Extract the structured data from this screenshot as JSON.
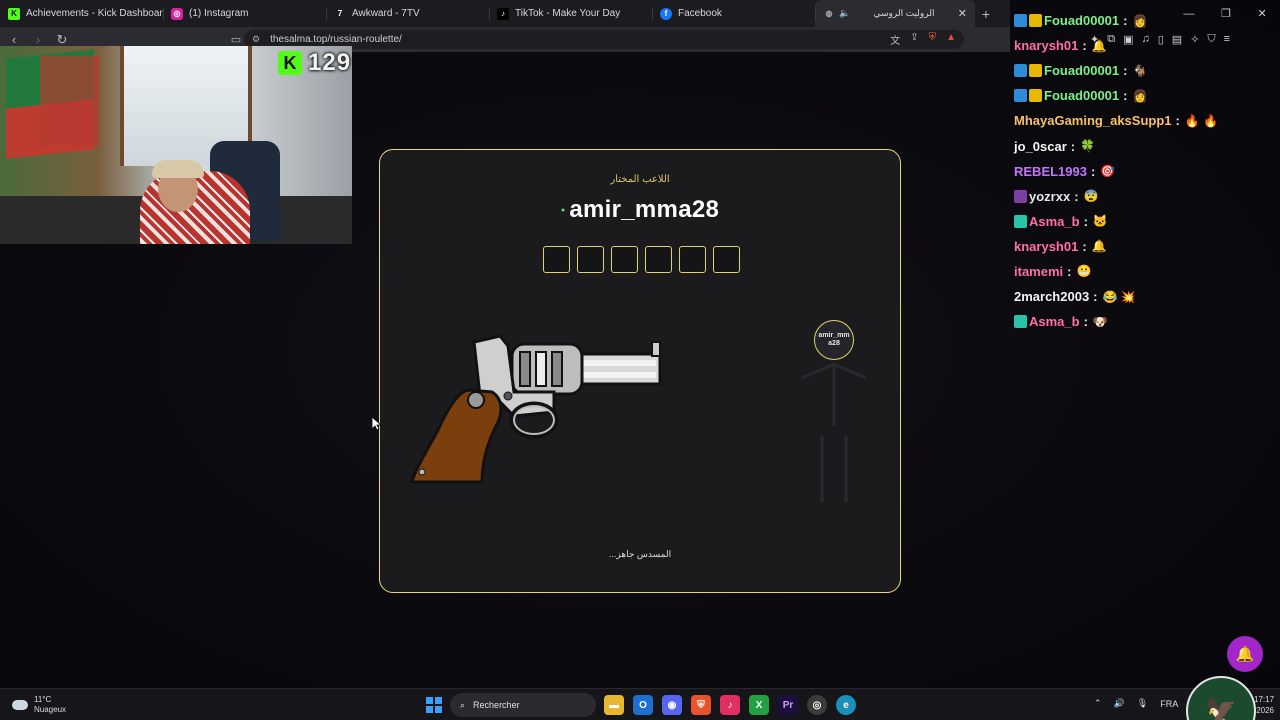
{
  "browser": {
    "tabs": [
      {
        "title": "Achievements - Kick Dashboard",
        "icon": "kick-icon",
        "color": "#53fc18"
      },
      {
        "title": "(1) Instagram",
        "icon": "instagram-icon",
        "color": "#d6249f"
      },
      {
        "title": "Awkward - 7TV",
        "icon": "7tv-icon",
        "color": "#ffffff"
      },
      {
        "title": "TikTok - Make Your Day",
        "icon": "tiktok-icon",
        "color": "#111111"
      },
      {
        "title": "Facebook",
        "icon": "facebook-icon",
        "color": "#1877f2"
      },
      {
        "title": "الروليت الروسي",
        "icon": "globe-icon",
        "color": "#888888"
      }
    ],
    "url": "thesalma.top/russian-roulette/"
  },
  "stream": {
    "viewer_count": "129",
    "platform_icon": "kick-icon",
    "platform_letter": "K"
  },
  "game": {
    "selected_label": "اللاعب المختار",
    "player_name": "amir_mma28",
    "online_dot": "●",
    "chamber_count": 6,
    "avatar_label": "amir_mma28",
    "status": "المسدس جاهز...",
    "accent": "#e7d67a"
  },
  "chat": {
    "messages": [
      {
        "user": "Fouad00001",
        "color": "#7cf089",
        "badges": [
          "#2e8bd8",
          "#e6b800"
        ],
        "emote": "👩"
      },
      {
        "user": "knarysh01",
        "color": "#ff6fa9",
        "badges": [],
        "emote": "🔔"
      },
      {
        "user": "Fouad00001",
        "color": "#7cf089",
        "badges": [
          "#2e8bd8",
          "#e6b800"
        ],
        "emote": "🐐"
      },
      {
        "user": "Fouad00001",
        "color": "#7cf089",
        "badges": [
          "#2e8bd8",
          "#e6b800"
        ],
        "emote": "👩"
      },
      {
        "user": "MhayaGaming_aksSupp1",
        "color": "#f6c06b",
        "badges": [],
        "emote": "🔥 🔥"
      },
      {
        "user": "jo_0scar",
        "color": "#f5f5f5",
        "badges": [],
        "emote": "🍀"
      },
      {
        "user": "REBEL1993",
        "color": "#c376ff",
        "badges": [],
        "emote": "🎯"
      },
      {
        "user": "yozrxx",
        "color": "#e8e8e8",
        "badges": [
          "#7a3fa3"
        ],
        "emote": "😨"
      },
      {
        "user": "Asma_b",
        "color": "#ff6fa9",
        "badges": [
          "#27c4a8"
        ],
        "emote": "🐱"
      },
      {
        "user": "knarysh01",
        "color": "#ff6fa9",
        "badges": [],
        "emote": "🔔"
      },
      {
        "user": "itamemi",
        "color": "#ff6fa9",
        "badges": [],
        "emote": "😬"
      },
      {
        "user": "2march2003",
        "color": "#f5f5f5",
        "badges": [],
        "emote": "😂 💥"
      },
      {
        "user": "Asma_b",
        "color": "#ff6fa9",
        "badges": [
          "#27c4a8"
        ],
        "emote": "🐶"
      }
    ]
  },
  "taskbar": {
    "weather_temp": "11°C",
    "weather_desc": "Nuageux",
    "search_placeholder": "Rechercher",
    "language": "FRA",
    "time": "17:17",
    "date": "2026"
  }
}
